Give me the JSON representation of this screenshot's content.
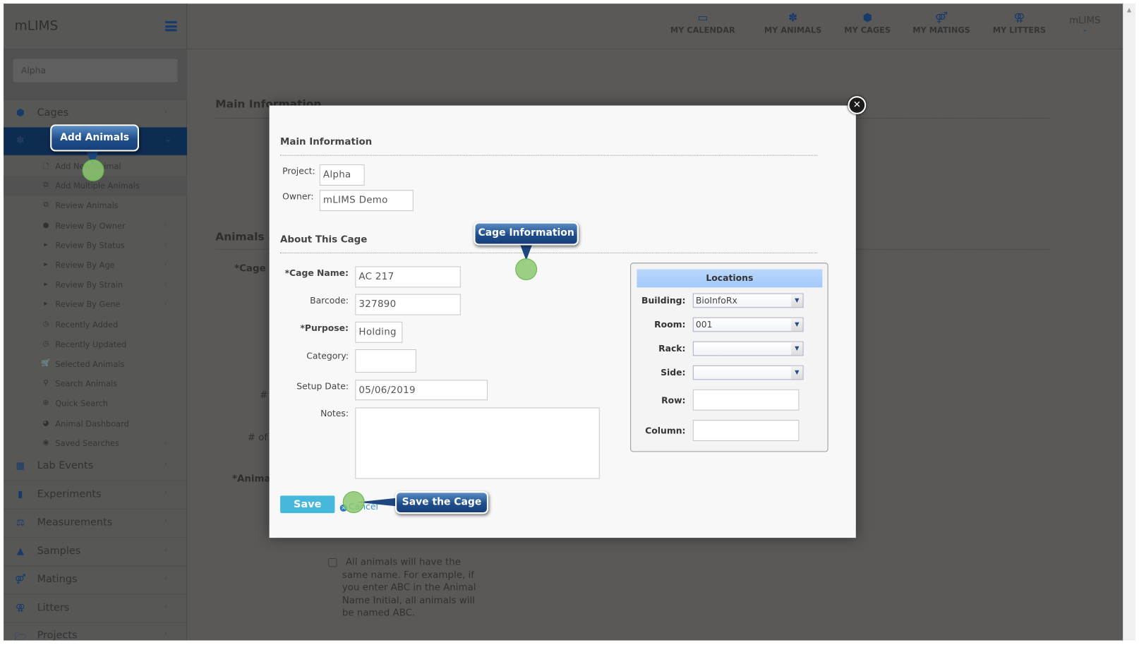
{
  "app": {
    "brand": "mLIMS",
    "project_search": "Alpha",
    "user_menu": "mLIMS"
  },
  "topnav": [
    {
      "label": "MY CALENDAR",
      "icon": "calendar-icon"
    },
    {
      "label": "MY ANIMALS",
      "icon": "paw-icon"
    },
    {
      "label": "MY CAGES",
      "icon": "cube-icon"
    },
    {
      "label": "MY MATINGS",
      "icon": "matings-icon"
    },
    {
      "label": "MY LITTERS",
      "icon": "litters-icon"
    }
  ],
  "sidebar": {
    "top": [
      {
        "label": "Cages",
        "icon": "cube-icon"
      },
      {
        "label": "Animals",
        "icon": "paw-icon"
      }
    ],
    "animal_items": [
      {
        "label": "Add New Animal",
        "icon": "file-icon"
      },
      {
        "label": "Add Multiple Animals",
        "icon": "files-icon"
      },
      {
        "label": "Review Animals",
        "icon": "copy-icon"
      },
      {
        "label": "Review By Owner",
        "icon": "user-icon"
      },
      {
        "label": "Review By Status",
        "icon": "caret-right-icon"
      },
      {
        "label": "Review By Age",
        "icon": "caret-right-icon"
      },
      {
        "label": "Review By Strain",
        "icon": "caret-right-icon"
      },
      {
        "label": "Review By Gene",
        "icon": "caret-right-icon"
      },
      {
        "label": "Recently Added",
        "icon": "clock-icon"
      },
      {
        "label": "Recently Updated",
        "icon": "clock-icon"
      },
      {
        "label": "Selected Animals",
        "icon": "cart-icon"
      },
      {
        "label": "Search Animals",
        "icon": "search-icon"
      },
      {
        "label": "Quick Search",
        "icon": "zoom-in-icon"
      },
      {
        "label": "Animal Dashboard",
        "icon": "pie-chart-icon"
      },
      {
        "label": "Saved Searches",
        "icon": "dot-circle-icon"
      }
    ],
    "bottom": [
      {
        "label": "Lab Events",
        "icon": "calendar-icon"
      },
      {
        "label": "Experiments",
        "icon": "documents-icon"
      },
      {
        "label": "Measurements",
        "icon": "scale-icon"
      },
      {
        "label": "Samples",
        "icon": "flask-icon"
      },
      {
        "label": "Matings",
        "icon": "matings-icon"
      },
      {
        "label": "Litters",
        "icon": "litters-icon"
      },
      {
        "label": "Projects",
        "icon": "folder-icon"
      }
    ]
  },
  "background": {
    "main_info": "Main Information",
    "animals_section": "Animals &",
    "cage_label": "*Cage",
    "hash_label": "#",
    "num_of_label": "# of",
    "animal_label": "*Anima",
    "same_name_note": "All animals will have the same name. For example, if you enter ABC in the Animal Name Initial, all animals will be named ABC."
  },
  "modal": {
    "main_info_title": "Main Information",
    "project_label": "Project:",
    "project_value": "Alpha",
    "owner_label": "Owner:",
    "owner_value": "mLIMS Demo",
    "about_title": "About This Cage",
    "fields": {
      "cage_name_label": "*Cage Name:",
      "cage_name": "AC 217",
      "barcode_label": "Barcode:",
      "barcode": "327890",
      "purpose_label": "*Purpose:",
      "purpose": "Holding",
      "category_label": "Category:",
      "category": "",
      "setup_date_label": "Setup Date:",
      "setup_date": "05/06/2019",
      "notes_label": "Notes:",
      "notes": ""
    },
    "locations": {
      "title": "Locations",
      "building_label": "Building:",
      "building": "BioInfoRx",
      "room_label": "Room:",
      "room": "001",
      "rack_label": "Rack:",
      "rack": "",
      "side_label": "Side:",
      "side": "",
      "row_label": "Row:",
      "row": "",
      "column_label": "Column:",
      "column": ""
    },
    "save_label": "Save",
    "cancel_label": "Cancel",
    "close_icon": "close-icon"
  },
  "callouts": {
    "add_animals": "Add Animals",
    "cage_information": "Cage Information",
    "save_the_cage": "Save the Cage"
  },
  "colors": {
    "save_button": "#45b8dc",
    "callout": "#1f4e8c",
    "locations_header": "#a9cdfb",
    "active_nav": "#0d2c52"
  }
}
